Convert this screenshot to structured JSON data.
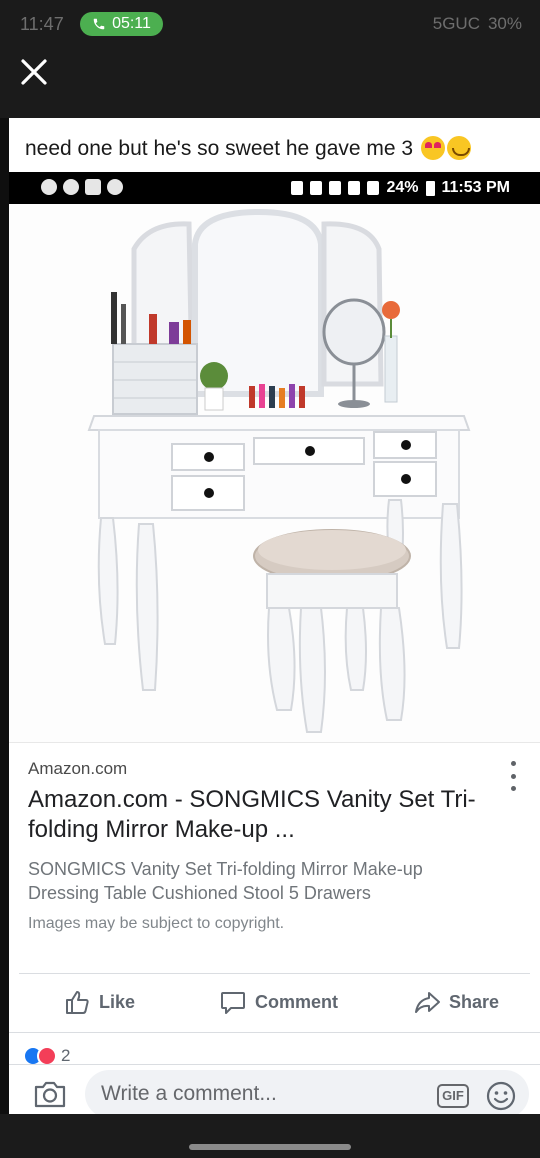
{
  "status_bar": {
    "time": "11:47",
    "call_duration": "05:11",
    "network": "5GUC",
    "battery": "30%"
  },
  "caption": {
    "text": "need one but he's so sweet he gave me 3"
  },
  "inner_status": {
    "battery": "24%",
    "time": "11:53 PM"
  },
  "result": {
    "site": "Amazon.com",
    "title": "Amazon.com - SONGMICS Vanity Set Tri-folding Mirror Make-up ...",
    "description": "SONGMICS Vanity Set Tri-folding Mirror Make-up Dressing Table Cushioned Stool 5 Drawers",
    "copyright": "Images may be subject to copyright."
  },
  "actions": {
    "like": "Like",
    "comment": "Comment",
    "share": "Share",
    "reaction_count": "2"
  },
  "comment_bar": {
    "placeholder": "Write a comment...",
    "gif_label": "GIF"
  },
  "icons": [
    "close-icon",
    "phone-icon",
    "camera-icon",
    "like-icon",
    "comment-icon",
    "share-icon",
    "emoji-icon",
    "more-options-icon"
  ]
}
